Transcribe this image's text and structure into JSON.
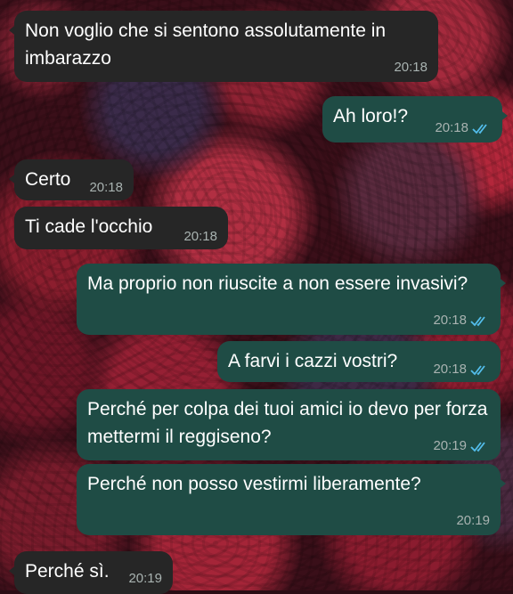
{
  "colors": {
    "incoming_bubble": "#262626",
    "outgoing_bubble": "#1f4c45",
    "read_ticks": "#53bdeb",
    "timestamp": "#a9b3b1"
  },
  "messages": [
    {
      "text": "Non voglio che si sentono assolutamente in imbarazzo",
      "time": "20:18",
      "direction": "incoming"
    },
    {
      "text": "Ah loro!?",
      "time": "20:18",
      "direction": "outgoing",
      "status_icon": "double-check-read-icon"
    },
    {
      "text": "Certo",
      "time": "20:18",
      "direction": "incoming"
    },
    {
      "text": "Ti cade l'occhio",
      "time": "20:18",
      "direction": "incoming"
    },
    {
      "text": "Ma proprio non riuscite a non essere invasivi?",
      "time": "20:18",
      "direction": "outgoing",
      "status_icon": "double-check-read-icon"
    },
    {
      "text": "A farvi i cazzi vostri?",
      "time": "20:18",
      "direction": "outgoing",
      "status_icon": "double-check-read-icon"
    },
    {
      "text": "Perché per colpa dei tuoi amici io devo per forza mettermi il reggiseno?",
      "time": "20:19",
      "direction": "outgoing",
      "status_icon": "double-check-read-icon"
    },
    {
      "text": "Perché non posso vestirmi liberamente?",
      "time": "20:19",
      "direction": "outgoing"
    },
    {
      "text": "Perché sì.",
      "time": "20:19",
      "direction": "incoming"
    }
  ]
}
